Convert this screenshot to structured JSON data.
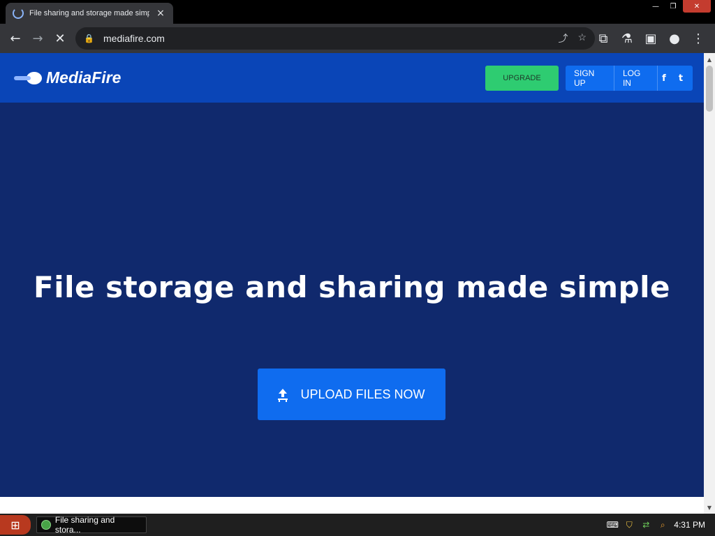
{
  "browser": {
    "tab_title": "File sharing and storage made simple",
    "tab_close": "×",
    "url": "mediafire.com",
    "controls": {
      "minimize": "—",
      "restore": "❐",
      "close": "✕"
    },
    "toolbar": {
      "back": "←",
      "forward": "→",
      "stop": "✕",
      "share": "⤴",
      "star": "☆",
      "extensions": "⧉",
      "labs": "⚗",
      "sidepanel": "▣",
      "profile": "●",
      "menu": "⋮"
    }
  },
  "site": {
    "logo_text": "MediaFire",
    "upgrade_label": "UPGRADE",
    "signup_label": "SIGN UP",
    "login_label": "LOG IN",
    "facebook_glyph": "f",
    "twitter_glyph": "t",
    "hero_title": "File storage and sharing made simple",
    "upload_label": "UPLOAD FILES NOW"
  },
  "taskbar": {
    "start_glyph": "⊞",
    "task_label": "File sharing and stora...",
    "time": "4:31 PM",
    "keyboard_glyph": "⌨",
    "shield_glyph": "⛉",
    "network_glyph": "⇄",
    "search_glyph": "⌕"
  },
  "colors": {
    "header_bg": "#0a45b7",
    "hero_bg": "#10296d",
    "accent_blue": "#0f6cef",
    "upgrade_green": "#2ecc71"
  }
}
